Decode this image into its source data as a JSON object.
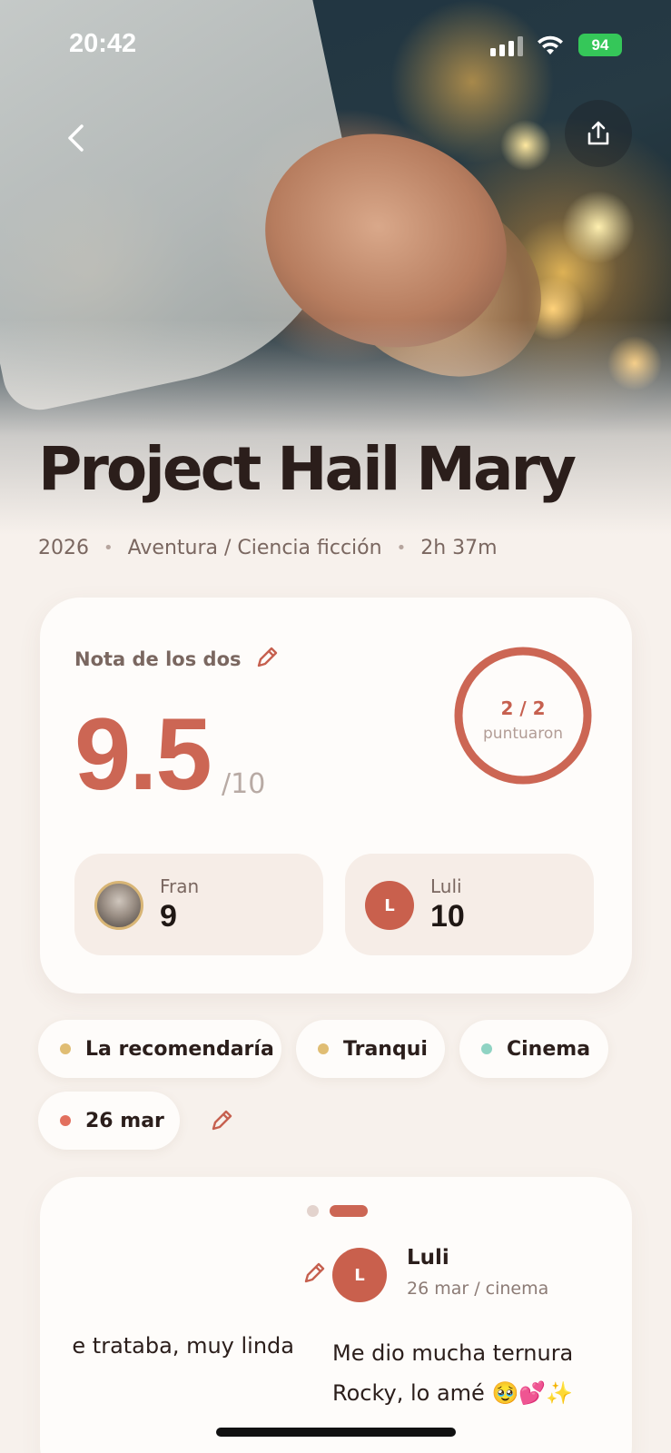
{
  "status": {
    "time": "20:42",
    "battery": "94"
  },
  "movie": {
    "title": "Project Hail Mary",
    "year": "2026",
    "genres": "Aventura / Ciencia ficción",
    "duration": "2h 37m"
  },
  "score": {
    "label": "Nota de los dos",
    "value": "9.5",
    "max": "/10",
    "raters_count": "2 / 2",
    "raters_label": "puntuaron",
    "raters_fraction": 1.0,
    "voters": [
      {
        "name": "Fran",
        "score": "9",
        "avatar": "dog-photo"
      },
      {
        "name": "Luli",
        "score": "10",
        "initial": "L"
      }
    ]
  },
  "tags": [
    {
      "label": "La recomendaría",
      "dot_color": "#e0bd73"
    },
    {
      "label": "Tranqui",
      "dot_color": "#e0bd73"
    },
    {
      "label": "Cinema",
      "dot_color": "#8fd3c3"
    },
    {
      "label": "26 mar",
      "dot_color": "#e2705e"
    }
  ],
  "review": {
    "previous_fragment": "e trataba, muy linda",
    "author": "Luli",
    "initial": "L",
    "date": "26 mar / cinema",
    "text": "Me dio mucha ternura Rocky, lo amé 🥹💕✨"
  },
  "colors": {
    "accent": "#cc6654",
    "background": "#f7f1ec",
    "card": "#fefcfa"
  },
  "icons": [
    "back-icon",
    "share-icon",
    "pencil-icon",
    "signal-icon",
    "wifi-icon"
  ]
}
